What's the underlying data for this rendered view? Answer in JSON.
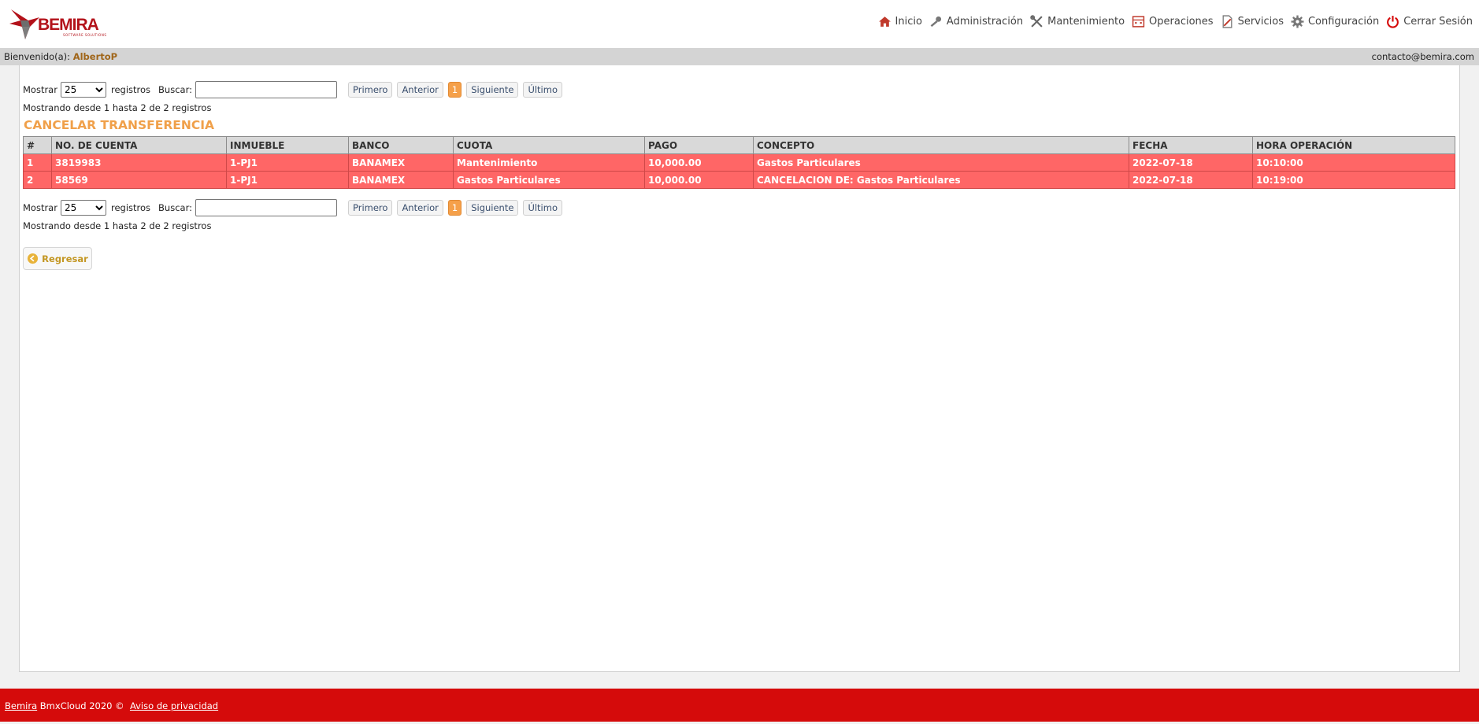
{
  "header": {
    "logo_text": "BEMIRA",
    "logo_subtext": "SOFTWARE SOLUTIONS",
    "nav": [
      {
        "label": "Inicio",
        "icon": "home-icon"
      },
      {
        "label": "Administración",
        "icon": "key-icon"
      },
      {
        "label": "Mantenimiento",
        "icon": "tools-icon"
      },
      {
        "label": "Operaciones",
        "icon": "calculator-icon"
      },
      {
        "label": "Servicios",
        "icon": "document-icon"
      },
      {
        "label": "Configuración",
        "icon": "gear-icon"
      },
      {
        "label": "Cerrar Sesión",
        "icon": "power-icon"
      }
    ]
  },
  "welcome": {
    "prefix": "Bienvenido(a):",
    "user": "AlbertoP",
    "email": "contacto@bemira.com"
  },
  "controls": {
    "show_label": "Mostrar",
    "show_value": "25",
    "records_label": "registros",
    "search_label": "Buscar:",
    "search_value": "",
    "first": "Primero",
    "previous": "Anterior",
    "current_page": "1",
    "next": "Siguiente",
    "last": "Último",
    "info": "Mostrando desde 1 hasta 2 de 2 registros"
  },
  "title": "CANCELAR TRANSFERENCIA",
  "table": {
    "headers": [
      "#",
      "NO. DE CUENTA",
      "INMUEBLE",
      "BANCO",
      "CUOTA",
      "PAGO",
      "CONCEPTO",
      "FECHA",
      "HORA OPERACIÓN"
    ],
    "rows": [
      [
        "1",
        "3819983",
        "1-PJ1",
        "BANAMEX",
        "Mantenimiento",
        "10,000.00",
        "Gastos Particulares",
        "2022-07-18",
        "10:10:00"
      ],
      [
        "2",
        "58569",
        "1-PJ1",
        "BANAMEX",
        "Gastos Particulares",
        "10,000.00",
        "CANCELACION DE: Gastos Particulares",
        "2022-07-18",
        "10:19:00"
      ]
    ]
  },
  "back_button": "Regresar",
  "footer": {
    "brand_link": "Bemira",
    "text": " BmxCloud 2020 ©  ",
    "privacy_link": "Aviso de privacidad"
  },
  "colors": {
    "brand_red": "#d50b0b",
    "accent_orange": "#f0a04a",
    "row_red": "#ff6666"
  }
}
